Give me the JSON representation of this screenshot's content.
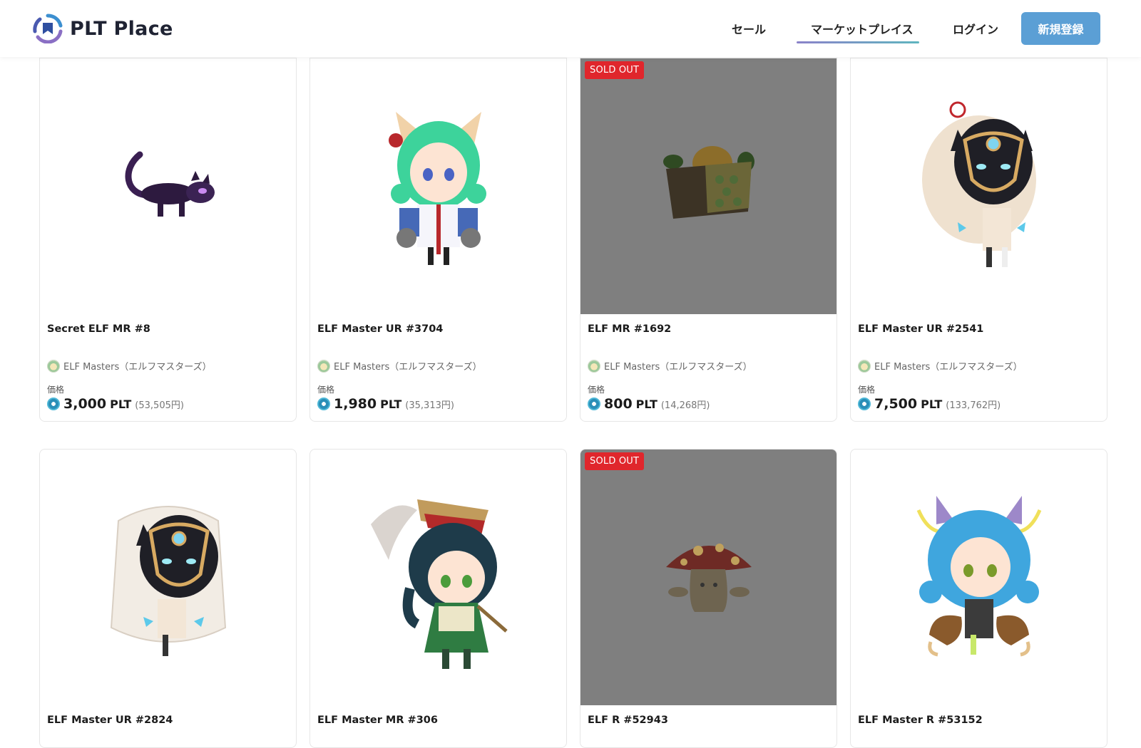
{
  "header": {
    "logo_text": "PLT Place",
    "nav": {
      "sale": "セール",
      "market": "マーケットプレイス",
      "login": "ログイン"
    },
    "signup_label": "新規登録"
  },
  "price_label": "価格",
  "price_unit": "PLT",
  "cards": [
    {
      "name": "Secret ELF MR #8",
      "collection": "ELF Masters（エルフマスターズ）",
      "price": "3,000",
      "yen": "(53,505円)",
      "sold_out": false,
      "image": "purple-dragon"
    },
    {
      "name": "ELF Master UR #3704",
      "collection": "ELF Masters（エルフマスターズ）",
      "price": "1,980",
      "yen": "(35,313円)",
      "sold_out": false,
      "image": "green-hair-cat-girl"
    },
    {
      "name": "ELF MR #1692",
      "collection": "ELF Masters（エルフマスターズ）",
      "price": "800",
      "yen": "(14,268円)",
      "sold_out": true,
      "badge": "SOLD OUT",
      "image": "bee-house"
    },
    {
      "name": "ELF Master UR #2541",
      "collection": "ELF Masters（エルフマスターズ）",
      "price": "7,500",
      "yen": "(133,762円)",
      "sold_out": false,
      "image": "masked-panther-girl"
    },
    {
      "name": "ELF Master UR #2824",
      "sold_out": false,
      "image": "masked-panther-girl-veil"
    },
    {
      "name": "ELF Master MR #306",
      "sold_out": false,
      "image": "dark-hair-green-dress-girl"
    },
    {
      "name": "ELF R #52943",
      "sold_out": true,
      "badge": "SOLD OUT",
      "image": "mushroom"
    },
    {
      "name": "ELF Master R #53152",
      "sold_out": false,
      "image": "blue-hair-crab-girl"
    }
  ],
  "colors": {
    "accent": "#5b9fd5",
    "sold_badge": "#e0262c",
    "sold_bg": "#7f7f7f"
  }
}
